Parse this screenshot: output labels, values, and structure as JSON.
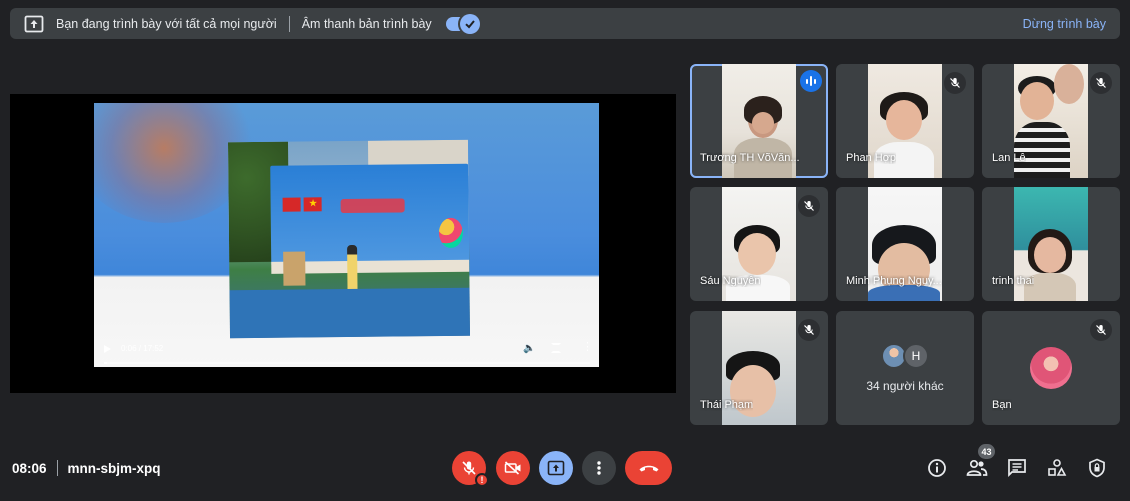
{
  "banner": {
    "presenting_text": "Bạn đang trình bày với tất cả mọi người",
    "audio_label": "Âm thanh bản trình bày",
    "audio_enabled": true,
    "stop_label": "Dừng trình bày"
  },
  "video": {
    "time": "0:06 / 17:52",
    "progress": 0.006
  },
  "participants": [
    {
      "name": "Trương TH VõVăn...",
      "state": "speaking"
    },
    {
      "name": "Phan Hợp",
      "state": "muted"
    },
    {
      "name": "Lan Lê",
      "state": "muted"
    },
    {
      "name": "Sáu Nguyễn",
      "state": "muted"
    },
    {
      "name": "Minh Phụng Nguy...",
      "state": "muted"
    },
    {
      "name": "trinh thai",
      "state": "muted"
    },
    {
      "name": "Thái Phạm",
      "state": "muted"
    }
  ],
  "others": {
    "initial": "H",
    "label": "34 người khác"
  },
  "self": {
    "name": "Bạn"
  },
  "meeting": {
    "time": "08:06",
    "code": "mnn-sbjm-xpq"
  },
  "people_count": "43",
  "colors": {
    "accent": "#8ab4f8",
    "danger": "#ea4335",
    "surface": "#3c4043",
    "background": "#202124"
  }
}
